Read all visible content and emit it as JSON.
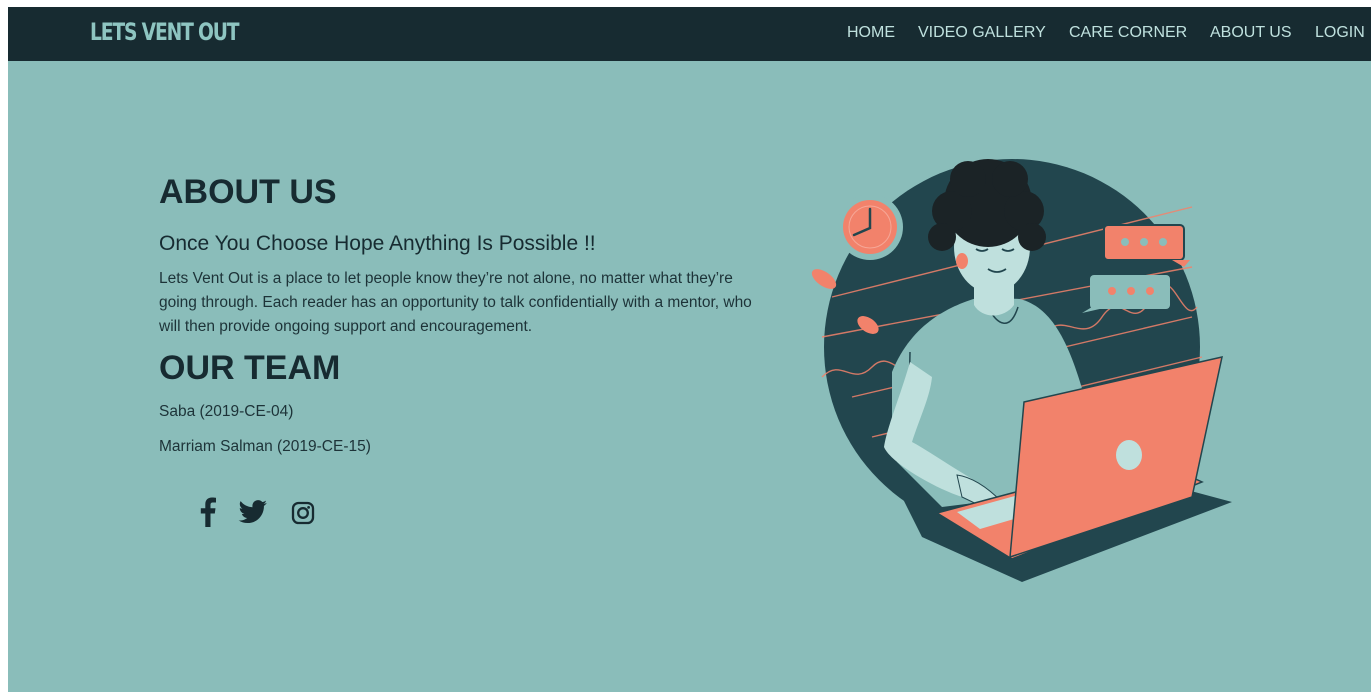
{
  "brand": {
    "name": "LETS VENT OUT"
  },
  "nav": {
    "home": "HOME",
    "video_gallery": "VIDEO GALLERY",
    "care_corner": "CARE CORNER",
    "about_us": "ABOUT US",
    "login": "LOGIN"
  },
  "about": {
    "title": "ABOUT US",
    "tagline": "Once You Choose Hope Anything Is Possible !!",
    "description": "Lets Vent Out is a place to let people know they’re not alone, no matter what they’re going through. Each reader has an opportunity to talk confidentially with a mentor, who will then provide ongoing support and encouragement."
  },
  "team": {
    "title": "OUR TEAM",
    "members": [
      "Saba (2019-CE-04)",
      "Marriam Salman (2019-CE-15)"
    ]
  },
  "social": {
    "icons": [
      "facebook-icon",
      "twitter-icon",
      "instagram-icon"
    ]
  },
  "colors": {
    "background": "#8abdba",
    "navbar": "#172b31",
    "accent": "#f2826b",
    "text": "#172b31"
  }
}
